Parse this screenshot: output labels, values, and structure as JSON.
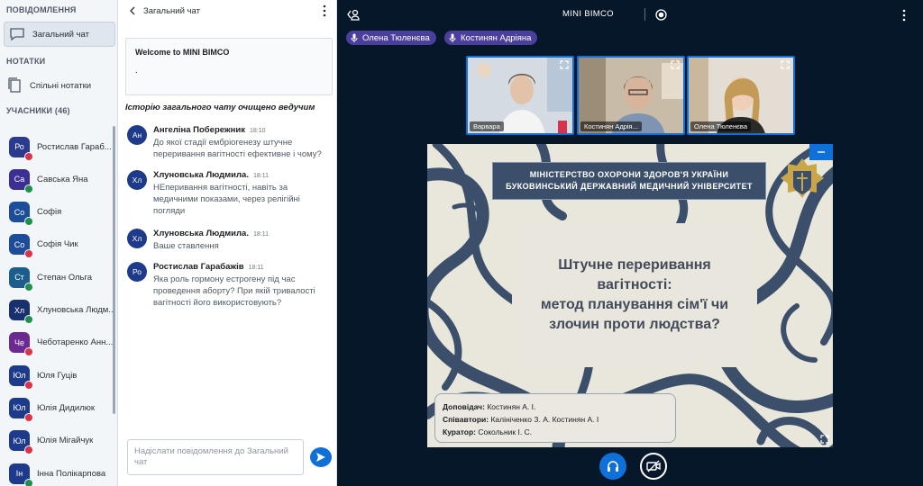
{
  "sidebar": {
    "messages_title": "ПОВІДОМЛЕННЯ",
    "public_chat": "Загальний чат",
    "notes_title": "НОТАТКИ",
    "shared_notes": "Спільні нотатки",
    "participants_title": "УЧАСНИКИ (46)",
    "users": [
      {
        "initials": "Ро",
        "name": "Ростислав Гараб...",
        "status": "red",
        "color": "#2a3a8f"
      },
      {
        "initials": "Са",
        "name": "Савська Яна",
        "status": "green",
        "color": "#3b2f93"
      },
      {
        "initials": "Со",
        "name": "Софія",
        "status": "green",
        "color": "#1d4d9a"
      },
      {
        "initials": "Со",
        "name": "Софія Чик",
        "status": "red",
        "color": "#1d4d9a"
      },
      {
        "initials": "Ст",
        "name": "Степан Ольга",
        "status": "green",
        "color": "#1b5d8c"
      },
      {
        "initials": "Хл",
        "name": "Хлуновська Людм...",
        "status": "green",
        "color": "#19306e"
      },
      {
        "initials": "Че",
        "name": "Чеботаренко Анн...",
        "status": "red",
        "color": "#6a2a8f"
      },
      {
        "initials": "Юл",
        "name": "Юля Гуців",
        "status": "red",
        "color": "#1e3a8a"
      },
      {
        "initials": "Юл",
        "name": "Юлія Дидилюк",
        "status": "red",
        "color": "#1e3a8a"
      },
      {
        "initials": "Юл",
        "name": "Юлія Мігайчук",
        "status": "red",
        "color": "#1e3a8a"
      },
      {
        "initials": "Ін",
        "name": "Інна Полікарпова",
        "status": "green",
        "color": "#1e3a8a"
      }
    ]
  },
  "chat": {
    "header": "Загальний чат",
    "welcome": "Welcome to MINI BIMCO",
    "welcome_dot": ".",
    "cleared_notice": "Історію загального чату очищено ведучим",
    "messages": [
      {
        "initials": "Ан",
        "author": "Ангеліна Побережник",
        "time": "18:10",
        "text": "До якої стадії ембріогенезу штучне переривання вагітності ефективне і чому?"
      },
      {
        "initials": "Хл",
        "author": "Хлуновська Людмила.",
        "time": "18:11",
        "text": "НЕперивання вагітності, навіть за медичними показами, через релігійні погляди"
      },
      {
        "initials": "Хл",
        "author": "Хлуновська Людмила.",
        "time": "18:11",
        "text": "Ваше ставлення"
      },
      {
        "initials": "Ро",
        "author": "Ростислав Гарабажів",
        "time": "18:11",
        "text": "Яка роль гормону естрогену під час проведення аборту? При якій тривалості вагітності його використовують?"
      }
    ],
    "input_placeholder": "Надіслати повідомлення до Загальний чат"
  },
  "main": {
    "title": "MINI BIMCO",
    "talkers": [
      "Олена Тюленєва",
      "Костинян Адріяна"
    ],
    "cameras": [
      "Варвара",
      "Костинян Адрія...",
      "Олена Тюленєва"
    ]
  },
  "slide": {
    "header_line1": "МІНІСТЕРСТВО ОХОРОНИ ЗДОРОВ'Я УКРАЇНИ",
    "header_line2": "БУКОВИНСЬКИЙ ДЕРЖАВНИЙ МЕДИЧНИЙ УНІВЕРСИТЕТ",
    "title_line1": "Штучне переривання",
    "title_line2": "вагітності:",
    "title_line3": "метод планування сім'ї чи",
    "title_line4": "злочин проти людства?",
    "speaker_label": "Доповідач:",
    "speaker": "Костинян А. І.",
    "coauthors_label": "Співавтори:",
    "coauthors": "Калініченко З. А. Костинян А. І",
    "curator_label": "Куратор:",
    "curator": "Сокольник І. С."
  },
  "colors": {
    "accent": "#0f70d7",
    "main_bg": "#06172a",
    "talker_bg": "#4a3f9c",
    "slide_dark": "#3b4f6b"
  }
}
